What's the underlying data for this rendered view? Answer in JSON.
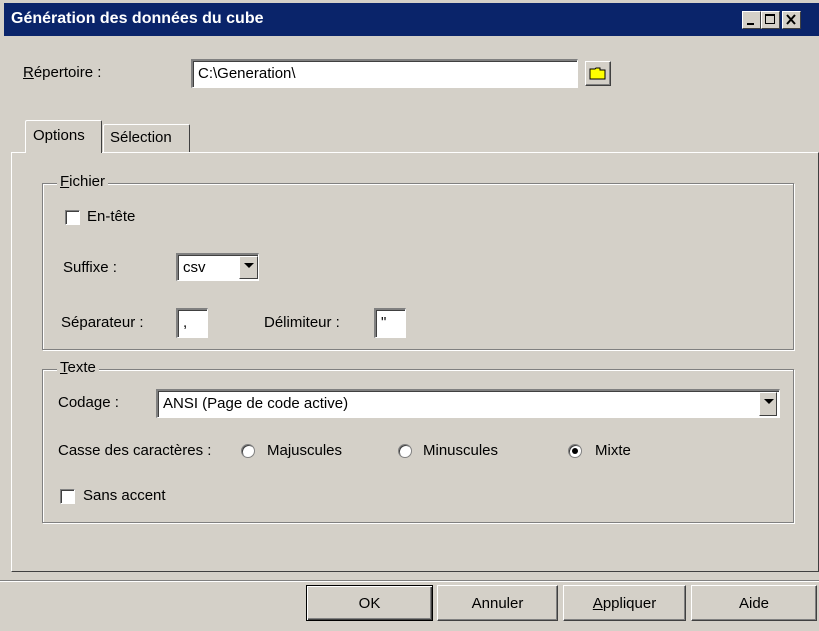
{
  "window": {
    "title": "Génération des données du cube"
  },
  "directory": {
    "label_mnemonic": "R",
    "label_rest": "épertoire :",
    "value": "C:\\Generation\\"
  },
  "tabs": [
    {
      "label": "Options",
      "selected": true
    },
    {
      "label": "Sélection",
      "selected": false
    }
  ],
  "file_group": {
    "title_mnemonic": "F",
    "title_rest": "ichier",
    "header_label": "En-tête",
    "header_checked": false,
    "suffix_label": "Suffixe :",
    "suffix_value": "csv",
    "separator_label": "Séparateur :",
    "separator_value": ",",
    "delimiter_label": "Délimiteur :",
    "delimiter_value": "\""
  },
  "text_group": {
    "title_mnemonic": "T",
    "title_rest": "exte",
    "encoding_label": "Codage :",
    "encoding_value": "ANSI (Page de code active)",
    "case_label": "Casse des caractères :",
    "case_options": [
      {
        "label": "Majuscules",
        "selected": false
      },
      {
        "label": "Minuscules",
        "selected": false
      },
      {
        "label": "Mixte",
        "selected": true
      }
    ],
    "no_accent_label": "Sans accent",
    "no_accent_checked": false
  },
  "buttons": {
    "ok": "OK",
    "cancel": "Annuler",
    "apply_mnemonic": "A",
    "apply_rest": "ppliquer",
    "help": "Aide"
  },
  "colors": {
    "titlebar": "#0a246a",
    "face": "#d4d0c8",
    "folder": "#ffff00"
  },
  "icons": [
    "minimize-icon",
    "maximize-icon",
    "close-icon",
    "folder-icon",
    "chevron-down-icon"
  ]
}
